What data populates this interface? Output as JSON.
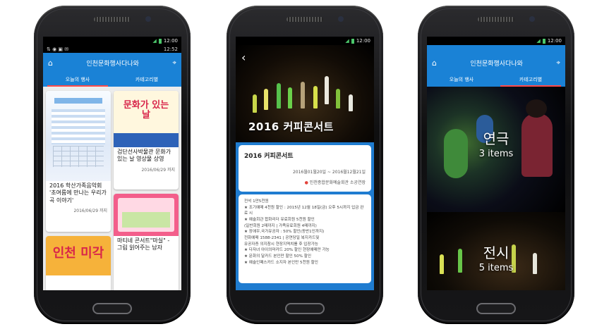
{
  "phone1": {
    "status_time": "12:52",
    "status_time_top": "12:00",
    "app_title": "인천문화행사다나와",
    "tabs": [
      "오늘의 행사",
      "카테고리별"
    ],
    "cards": [
      {
        "title": "2016 학산가족음악회 '초여름에 만나는 우리가곡 이야기'",
        "date": "2016/06/29 까지"
      },
      {
        "title": "검단선사박물관 문화가 있는 날 영상물 상영",
        "date": "2016/06/29 까지",
        "poster_text": "문화가 있는 날"
      },
      {
        "title": "마티네 콘서트\"마실\" - 그림 읽어주는 남자",
        "date": ""
      },
      {
        "title": "",
        "date": "",
        "poster_text": "인천 미각"
      }
    ]
  },
  "phone2": {
    "status_time": "12:00",
    "hero_title": "2016 커피콘서트",
    "event_title": "2016 커피콘서트",
    "period": "2016월01월20일 ~ 2016월12월21일",
    "venue": "인천종합문화예술회관 소공연장",
    "detail_lines": [
      "전석 1만5천원",
      "★ 조기예매 4천원 할인 : 2015년 12월 18일(금) 오후 5시까지 입금 완료 시",
      "★ 예술회관 합화리더 유료회원 5천원 할인",
      "(일반회원 2매까지 | 가족유료회원 4매까지)",
      "★ 장애우,국가유공자 : 50% 할인(동반1인까지)",
      "전화예매 1588-2341 | 공연당일 복지카드및",
      "유공자증 의지참시 현장지역치를 후 입장가능",
      "★ 다자녀 아이의마카드 20% 할인 현장예매만 가능",
      "★ 문화의 달카드 본인만 할인 50% 할인",
      "★ 예술인패스카드 소지자 본인만 5천원 할인"
    ]
  },
  "phone3": {
    "status_time": "12:00",
    "app_title": "인천문화행사다나와",
    "tabs": [
      "오늘의 행사",
      "카테고리별"
    ],
    "categories": [
      {
        "name": "연극",
        "count": "3 items"
      },
      {
        "name": "전시",
        "count": "5 items"
      }
    ]
  },
  "colors": {
    "primary": "#1a82d6",
    "tab_indicator": "#ff4a4a",
    "location_pin": "#e2433b"
  }
}
